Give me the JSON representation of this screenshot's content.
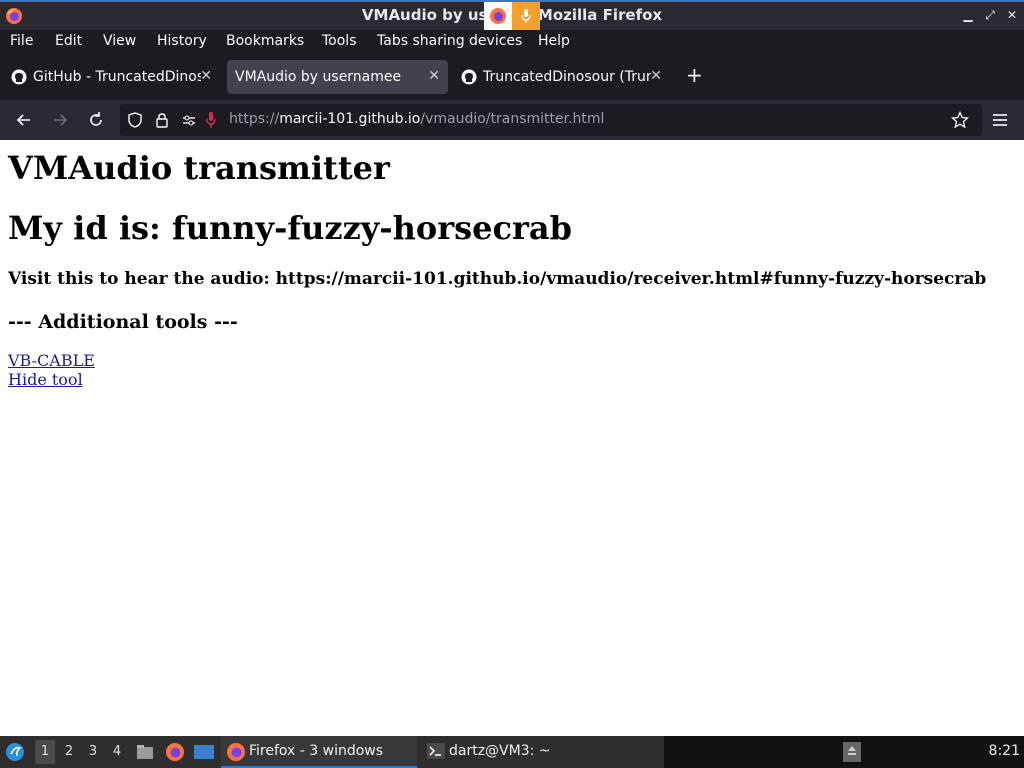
{
  "window": {
    "title": "VMAudio by userr — Mozilla Firefox",
    "controls": [
      "minimize-icon",
      "maximize-icon",
      "close-icon"
    ]
  },
  "menubar": {
    "items": [
      "File",
      "Edit",
      "View",
      "History",
      "Bookmarks",
      "Tools",
      "Tabs sharing devices",
      "Help"
    ]
  },
  "tabs": [
    {
      "label": "GitHub - TruncatedDinos",
      "icon": "github-icon",
      "active": false
    },
    {
      "label": "VMAudio by usernamee",
      "icon": "",
      "active": true
    },
    {
      "label": "TruncatedDinosour (Trunc",
      "icon": "github-icon",
      "active": false
    }
  ],
  "url": {
    "scheme": "https://",
    "host": "marcii-101.github.io",
    "path": "/vmaudio/transmitter.html"
  },
  "page": {
    "heading": "VMAudio transmitter",
    "id_line": "My id is: funny-fuzzy-horsecrab",
    "visit_line": "Visit this to hear the audio: https://marcii-101.github.io/vmaudio/receiver.html#funny-fuzzy-horsecrab",
    "tools_heading": "--- Additional tools ---",
    "links": [
      "VB-CABLE",
      "Hide tool"
    ]
  },
  "taskbar": {
    "workspaces": [
      "1",
      "2",
      "3",
      "4"
    ],
    "tasks": [
      {
        "label": "Firefox - 3 windows",
        "icon": "firefox-icon"
      },
      {
        "label": "dartz@VM3: ~",
        "icon": "terminal-icon"
      }
    ],
    "clock": "8:21"
  },
  "colors": {
    "accent": "#3b78c4",
    "link": "#1a1a9e",
    "sharing": "#f59f2c"
  }
}
